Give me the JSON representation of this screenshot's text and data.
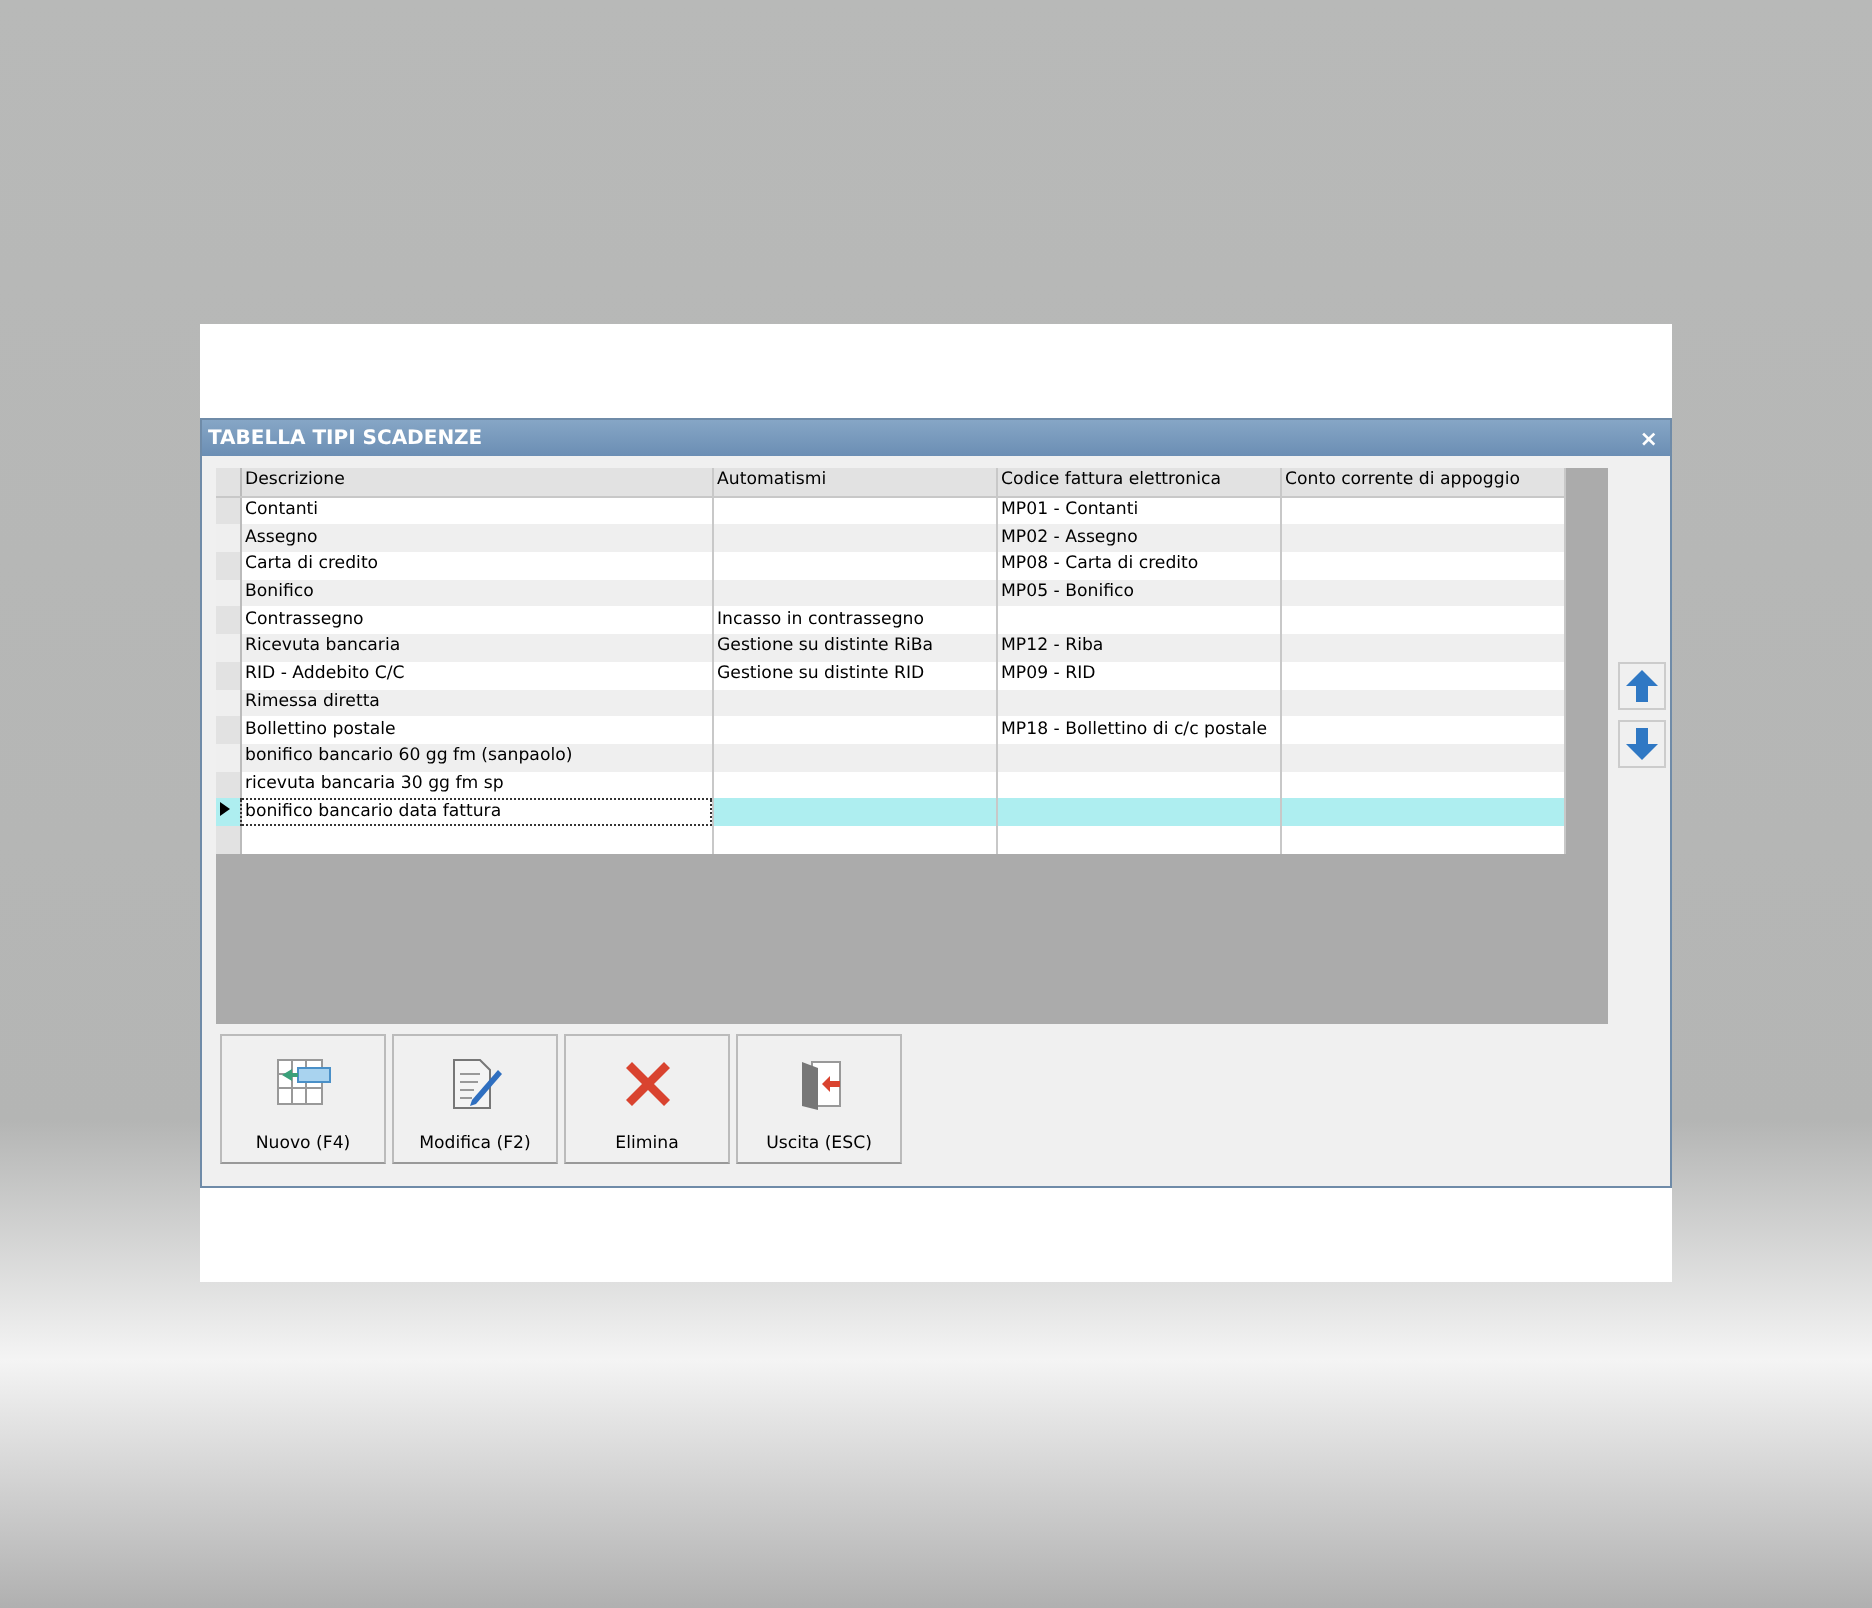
{
  "window": {
    "title": "TABELLA TIPI SCADENZE",
    "close": "×"
  },
  "table": {
    "columns": [
      "Descrizione",
      "Automatismi",
      "Codice fattura elettronica",
      "Conto corrente di appoggio"
    ],
    "rows": [
      {
        "cells": [
          "Contanti",
          "",
          "MP01 - Contanti",
          ""
        ],
        "selected": false
      },
      {
        "cells": [
          "Assegno",
          "",
          "MP02 - Assegno",
          ""
        ],
        "selected": false
      },
      {
        "cells": [
          "Carta di credito",
          "",
          "MP08 - Carta di credito",
          ""
        ],
        "selected": false
      },
      {
        "cells": [
          "Bonifico",
          "",
          "MP05 - Bonifico",
          ""
        ],
        "selected": false
      },
      {
        "cells": [
          "Contrassegno",
          "Incasso in contrassegno",
          "",
          ""
        ],
        "selected": false
      },
      {
        "cells": [
          "Ricevuta bancaria",
          "Gestione su distinte RiBa",
          "MP12 - Riba",
          ""
        ],
        "selected": false
      },
      {
        "cells": [
          "RID - Addebito C/C",
          "Gestione su distinte RID",
          "MP09 - RID",
          ""
        ],
        "selected": false
      },
      {
        "cells": [
          "Rimessa diretta",
          "",
          "",
          ""
        ],
        "selected": false
      },
      {
        "cells": [
          "Bollettino postale",
          "",
          "MP18 - Bollettino di c/c postale",
          ""
        ],
        "selected": false
      },
      {
        "cells": [
          "bonifico bancario 60 gg fm (sanpaolo)",
          "",
          "",
          ""
        ],
        "selected": false
      },
      {
        "cells": [
          "ricevuta bancaria 30 gg fm sp",
          "",
          "",
          ""
        ],
        "selected": false
      },
      {
        "cells": [
          "bonifico bancario data fattura",
          "",
          "",
          ""
        ],
        "selected": true
      }
    ]
  },
  "buttons": [
    {
      "kind": "new",
      "label": "Nuovo (F4)"
    },
    {
      "kind": "edit",
      "label": "Modifica (F2)"
    },
    {
      "kind": "delete",
      "label": "Elimina"
    },
    {
      "kind": "exit",
      "label": "Uscita (ESC)"
    }
  ]
}
